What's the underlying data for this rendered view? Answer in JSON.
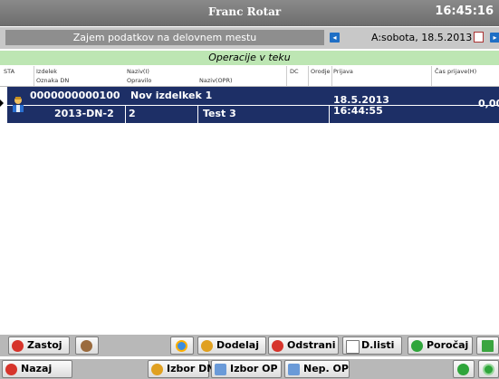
{
  "header": {
    "user_name": "Franc Rotar",
    "time": "16:45:16"
  },
  "info": {
    "workplace_caption": "Zajem podatkov na delovnem mestu",
    "date_label": "A:sobota, 18.5.2013"
  },
  "section_title": "Operacije v teku",
  "table": {
    "columns_row1": [
      "STA",
      "Izdelek",
      "Naziv(I)",
      "DC",
      "Orodje",
      "Prijava",
      "Čas prijave(H)"
    ],
    "columns_row2": [
      "Oznaka DN",
      "Opravilo",
      "Naziv(OPR)"
    ],
    "rows": [
      {
        "izdelek": "0000000000100",
        "naziv_i": "Nov izdelkek 1",
        "oznaka_dn": "2013-DN-2",
        "opravilo": "2",
        "naziv_opr": "Test 3",
        "prijava_date": "18.5.2013",
        "prijava_time": "16:44:55",
        "cas_prijave": "0,00"
      }
    ]
  },
  "toolbar1": {
    "zastoj": "Zastoj",
    "dodelaj": "Dodelaj",
    "odstrani": "Odstrani",
    "dlisti": "D.listi",
    "porocaj": "Poročaj"
  },
  "toolbar2": {
    "nazaj": "Nazaj",
    "izbor_dn": "Izbor DN",
    "izbor_op": "Izbor OP",
    "nep_op": "Nep. OP"
  },
  "colors": {
    "row_bg": "#1d2f66",
    "section_bg": "#bde6b3",
    "title_bg": "#6c6c6c",
    "accent_blue": "#1f6fc5"
  }
}
